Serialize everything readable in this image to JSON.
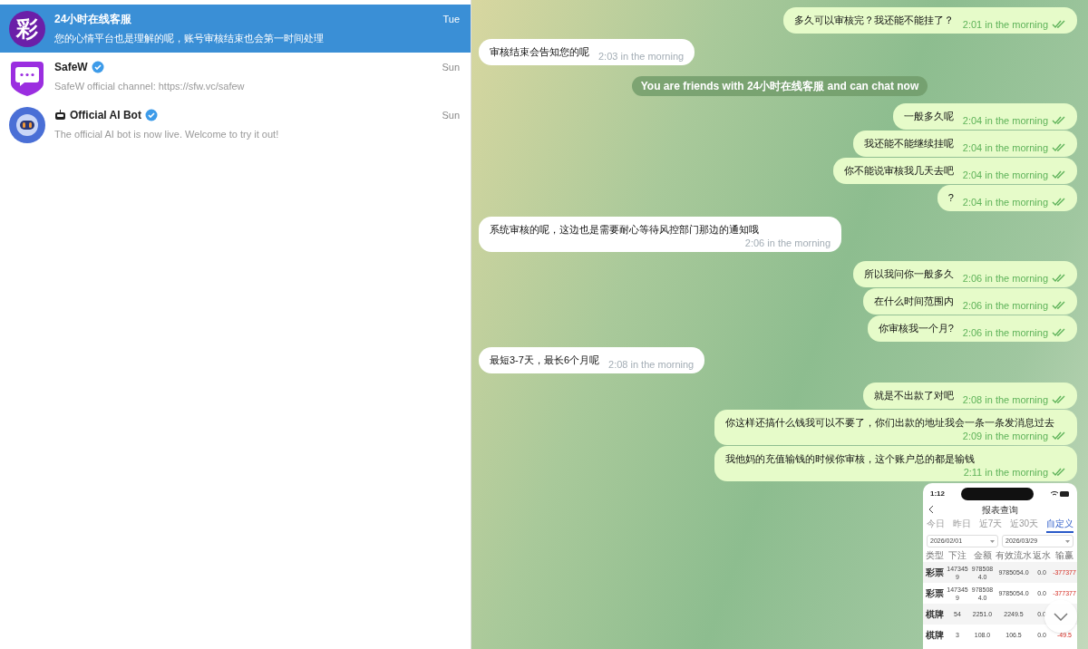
{
  "chats": [
    {
      "name": "24小时在线客服",
      "preview": "您的心情平台也是理解的呢，账号审核结束也会第一时间处理",
      "time": "Tue",
      "selected": true,
      "verified": false,
      "bot": false,
      "avatar": {
        "kind": "letter",
        "text": "彩"
      }
    },
    {
      "name": "SafeW",
      "preview": "SafeW official channel: https://sfw.vc/safew",
      "time": "Sun",
      "selected": false,
      "verified": true,
      "bot": false,
      "avatar": {
        "kind": "shield"
      }
    },
    {
      "name": "Official AI Bot",
      "preview": "The official AI bot is now live. Welcome to try it out!",
      "time": "Sun",
      "selected": false,
      "verified": true,
      "bot": true,
      "avatar": {
        "kind": "robot"
      }
    }
  ],
  "messages": [
    {
      "kind": "out",
      "text": "多久可以审核完？我还能不能挂了？",
      "time": "2:01 in the morning",
      "read": true
    },
    {
      "kind": "in",
      "text": "审核结束会告知您的呢",
      "time": "2:03 in the morning"
    },
    {
      "kind": "service",
      "text": "You are friends with 24小时在线客服 and can chat now"
    },
    {
      "kind": "out",
      "text": "一般多久呢",
      "time": "2:04 in the morning",
      "read": true
    },
    {
      "kind": "out",
      "text": "我还能不能继续挂呢",
      "time": "2:04 in the morning",
      "read": true
    },
    {
      "kind": "out",
      "text": "你不能说审核我几天去吧",
      "time": "2:04 in the morning",
      "read": true
    },
    {
      "kind": "out",
      "text": "?",
      "time": "2:04 in the morning",
      "read": true
    },
    {
      "kind": "in",
      "text": "系统审核的呢，这边也是需要耐心等待风控部门那边的通知哦",
      "time": "2:06 in the morning"
    },
    {
      "kind": "out",
      "text": "所以我问你一般多久",
      "time": "2:06 in the morning",
      "read": true
    },
    {
      "kind": "out",
      "text": "在什么时间范围内",
      "time": "2:06 in the morning",
      "read": true
    },
    {
      "kind": "out",
      "text": "你审核我一个月?",
      "time": "2:06 in the morning",
      "read": true
    },
    {
      "kind": "in",
      "text": "最短3-7天，最长6个月呢",
      "time": "2:08 in the morning"
    },
    {
      "kind": "out",
      "text": "就是不出款了对吧",
      "time": "2:08 in the morning",
      "read": true
    },
    {
      "kind": "out",
      "text": "你这样还搞什么钱我可以不要了，你们出款的地址我会一条一条发消息过去",
      "time": "2:09 in the morning",
      "read": true
    },
    {
      "kind": "out",
      "text": "我他妈的充值输钱的时候你审核，这个账户总的都是输钱",
      "time": "2:11 in the morning",
      "read": true
    },
    {
      "kind": "image",
      "screenshot": {
        "status_time": "1:12",
        "title": "报表查询",
        "tabs": [
          {
            "label": "今日",
            "selected": false
          },
          {
            "label": "昨日",
            "selected": false
          },
          {
            "label": "近7天",
            "selected": false
          },
          {
            "label": "近30天",
            "selected": false
          },
          {
            "label": "自定义",
            "selected": true
          }
        ],
        "date_from": "2026/02/01",
        "date_to": "2026/03/29",
        "columns": [
          "类型",
          "下注",
          "金额",
          "有效流水",
          "返水",
          "输赢"
        ],
        "rows": [
          [
            "彩票",
            "1473459",
            "9785084.0",
            "9785054.0",
            "0.0",
            "-377377"
          ],
          [
            "彩票",
            "1473459",
            "9785084.0",
            "9785054.0",
            "0.0",
            "-377377"
          ],
          [
            "棋牌",
            "54",
            "2251.0",
            "2249.5",
            "0.0"
          ],
          [
            "棋牌",
            "3",
            "108.0",
            "106.5",
            "0.0",
            "-49.5"
          ]
        ]
      }
    }
  ]
}
